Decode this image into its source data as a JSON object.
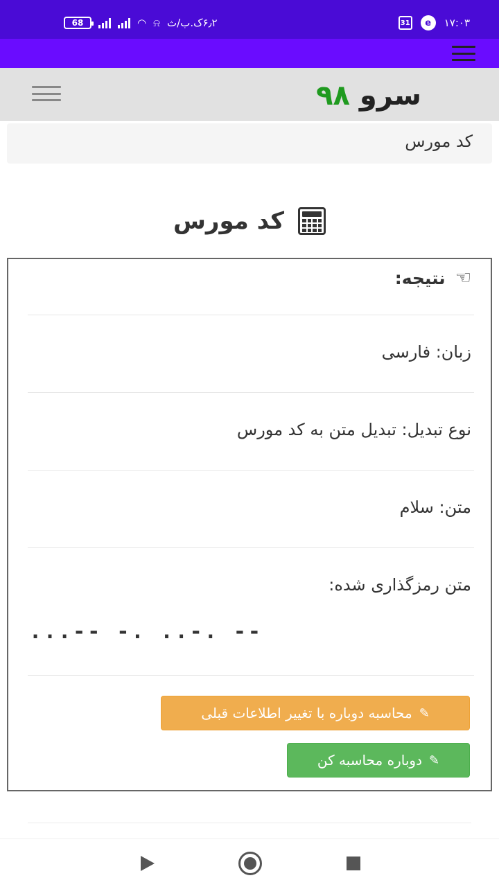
{
  "status_bar": {
    "battery": "68",
    "speed": "۶٫۲ک.ب/ث",
    "calendar": "31",
    "time": "۱۷:۰۳"
  },
  "header": {
    "logo_text": "سرو",
    "logo_number": "۹۸"
  },
  "breadcrumb": {
    "current": "کد مورس"
  },
  "page": {
    "title": "کد مورس"
  },
  "result": {
    "heading": "نتیجه:",
    "language": "زبان: فارسی",
    "conversion_type": "نوع تبدیل: تبدیل متن به کد مورس",
    "text": "متن: سلام",
    "encoded_label": "متن رمزگذاری شده:",
    "encoded_value": "...-- -. ..-. -- "
  },
  "buttons": {
    "recalc_with_change": "محاسبه دوباره با تغییر اطلاعات قبلی",
    "recalc": "دوباره محاسبه کن"
  },
  "colors": {
    "status_bar": "#4a0bd6",
    "purple_bar": "#6a0cff",
    "logo_number": "#1f9a1f",
    "button_orange": "#f0ad4e",
    "button_green": "#5cb85c"
  }
}
